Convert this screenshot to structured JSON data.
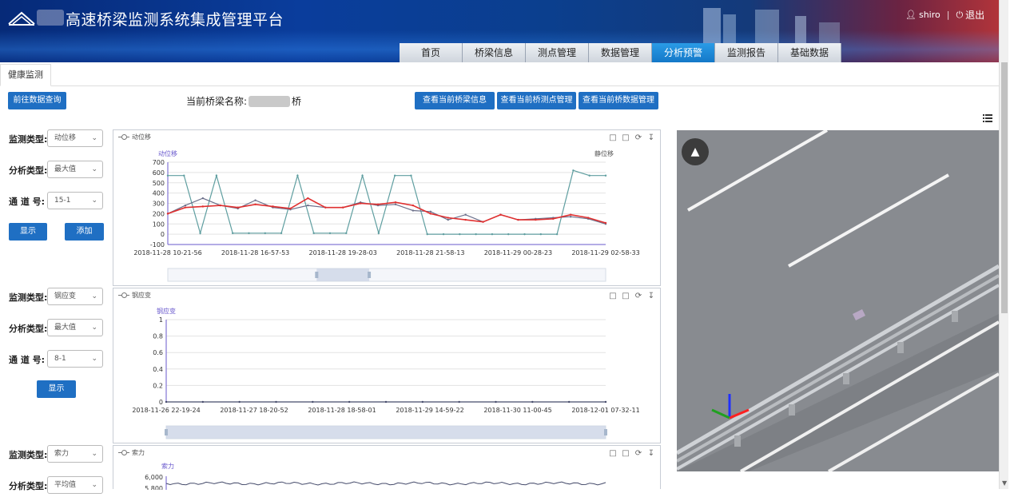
{
  "header": {
    "title": "高速桥梁监测系统集成管理平台",
    "user": "shiro",
    "logout": "退出"
  },
  "nav": {
    "tabs": [
      "首页",
      "桥梁信息",
      "测点管理",
      "数据管理",
      "分析预警",
      "监测报告",
      "基础数据"
    ],
    "active_index": 4
  },
  "subtab": "健康监测",
  "toolbar": {
    "history_btn": "前往数据查询",
    "bridge_label": "当前桥梁名称:",
    "bridge_suffix": "桥",
    "btn_info": "查看当前桥梁信息",
    "btn_points": "查看当前桥测点管理",
    "btn_data": "查看当前桥数据管理"
  },
  "controls": [
    {
      "type_label": "监测类型:",
      "type_value": "动位移",
      "analysis_label": "分析类型:",
      "analysis_value": "最大值",
      "channel_label": "通 道 号:",
      "channel_value": "15-1",
      "show_btn": "显示",
      "add_btn": "添加"
    },
    {
      "type_label": "监测类型:",
      "type_value": "钢应变",
      "analysis_label": "分析类型:",
      "analysis_value": "最大值",
      "channel_label": "通 道 号:",
      "channel_value": "8-1",
      "show_btn": "显示"
    },
    {
      "type_label": "监测类型:",
      "type_value": "索力",
      "analysis_label": "分析类型:",
      "analysis_value": "平均值"
    }
  ],
  "tool_icons": [
    "zoom-icon",
    "zoom-reset-icon",
    "restore-icon",
    "download-icon"
  ],
  "chart_data": [
    {
      "type": "line",
      "title": "动位移",
      "ylabel": "动位移",
      "ylabel_right": "静位移",
      "ylim": [
        -100,
        700
      ],
      "yticks": [
        700,
        600,
        500,
        400,
        300,
        200,
        100,
        0,
        -100
      ],
      "xlabels": [
        "2018-11-28 10-21-56",
        "2018-11-28 16-57-53",
        "2018-11-28 19-28-03",
        "2018-11-28 21-58-13",
        "2018-11-29 00-28-23",
        "2018-11-29 02-58-33"
      ],
      "series": [
        {
          "color": "#5f9ea0",
          "values": [
            570,
            570,
            10,
            570,
            10,
            10,
            10,
            10,
            570,
            10,
            10,
            10,
            570,
            10,
            570,
            570,
            0,
            0,
            0,
            0,
            0,
            0,
            0,
            0,
            0,
            620,
            570,
            570
          ]
        },
        {
          "color": "#6b6f8a",
          "values": [
            200,
            280,
            350,
            280,
            250,
            330,
            260,
            240,
            280,
            260,
            260,
            310,
            280,
            290,
            230,
            220,
            140,
            190,
            120,
            190,
            140,
            150,
            160,
            170,
            150,
            100
          ]
        },
        {
          "color": "#e03030",
          "values": [
            200,
            260,
            270,
            280,
            260,
            290,
            270,
            250,
            350,
            260,
            260,
            300,
            290,
            310,
            280,
            200,
            160,
            140,
            120,
            190,
            140,
            140,
            150,
            190,
            160,
            110
          ]
        }
      ]
    },
    {
      "type": "line",
      "title": "钢应变",
      "ylabel": "钢应变",
      "ylim": [
        0,
        1
      ],
      "yticks": [
        1,
        0.8,
        0.6,
        0.4,
        0.2,
        0
      ],
      "xlabels": [
        "2018-11-26 22-19-24",
        "2018-11-27 18-20-52",
        "2018-11-28 18-58-01",
        "2018-11-29 14-59-22",
        "2018-11-30 11-00-45",
        "2018-12-01 07-32-11"
      ],
      "series": [
        {
          "color": "#444a6a",
          "values": [
            0,
            0,
            0,
            0,
            0,
            0,
            0,
            0,
            0,
            0,
            0,
            0,
            0
          ]
        }
      ]
    },
    {
      "type": "line",
      "title": "索力",
      "ylabel": "索力",
      "yticks": [
        "6,000",
        "5,800"
      ],
      "series": [
        {
          "color": "#444a6a",
          "values": []
        }
      ]
    }
  ]
}
